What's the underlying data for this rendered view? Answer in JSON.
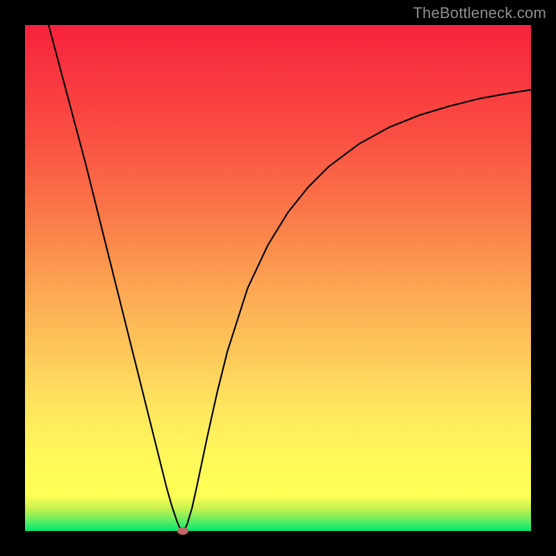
{
  "watermark": "TheBottleneck.com",
  "chart_data": {
    "type": "line",
    "title": "",
    "xlabel": "",
    "ylabel": "",
    "xlim": [
      0,
      1
    ],
    "ylim": [
      0,
      1
    ],
    "legend": false,
    "grid": false,
    "background": "heat-gradient-red-to-green",
    "minimum_point": {
      "x": 0.312,
      "y": 0.0
    },
    "series": [
      {
        "name": "bottleneck-curve",
        "color": "#000000",
        "x": [
          0.0,
          0.02,
          0.04,
          0.06,
          0.08,
          0.1,
          0.12,
          0.14,
          0.16,
          0.18,
          0.2,
          0.22,
          0.24,
          0.26,
          0.28,
          0.29,
          0.3,
          0.305,
          0.31,
          0.312,
          0.315,
          0.32,
          0.33,
          0.34,
          0.36,
          0.38,
          0.4,
          0.44,
          0.48,
          0.52,
          0.56,
          0.6,
          0.66,
          0.72,
          0.78,
          0.84,
          0.9,
          0.95,
          1.0
        ],
        "y": [
          1.175,
          1.1,
          1.025,
          0.95,
          0.875,
          0.8,
          0.725,
          0.645,
          0.565,
          0.485,
          0.405,
          0.325,
          0.245,
          0.165,
          0.085,
          0.05,
          0.02,
          0.008,
          0.002,
          0.0,
          0.003,
          0.012,
          0.045,
          0.09,
          0.185,
          0.275,
          0.355,
          0.48,
          0.565,
          0.63,
          0.68,
          0.72,
          0.765,
          0.798,
          0.822,
          0.84,
          0.855,
          0.864,
          0.872
        ]
      }
    ],
    "marker": {
      "x": 0.312,
      "y": 0.0,
      "color": "#c46565"
    }
  }
}
